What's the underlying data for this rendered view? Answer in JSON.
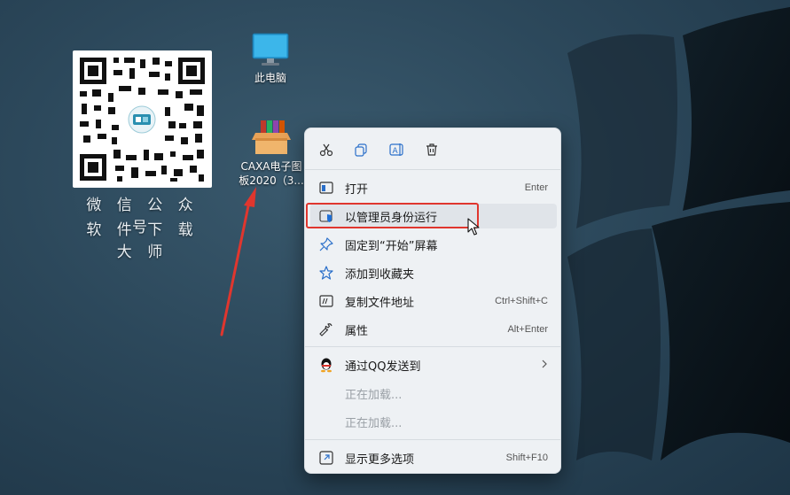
{
  "qr": {
    "caption_line1": "微 信 公 众 号",
    "caption_line2": "软 件 下 载 大 师"
  },
  "desktop_icons": [
    {
      "label": "此电脑",
      "icon": "monitor-icon"
    },
    {
      "label": "CAXA电子图板2020（3...",
      "icon": "package-box-icon"
    }
  ],
  "context_menu": {
    "toolbar": [
      {
        "name": "cut",
        "icon": "scissors-icon"
      },
      {
        "name": "copy",
        "icon": "copy-icon"
      },
      {
        "name": "rename",
        "icon": "rename-icon"
      },
      {
        "name": "delete",
        "icon": "trash-icon"
      }
    ],
    "items": [
      {
        "label": "打开",
        "shortcut": "Enter",
        "icon": "open-window-icon"
      },
      {
        "label": "以管理员身份运行",
        "shortcut": "",
        "icon": "shield-icon",
        "highlighted": true
      },
      {
        "label": "固定到“开始”屏幕",
        "shortcut": "",
        "icon": "pin-icon"
      },
      {
        "label": "添加到收藏夹",
        "shortcut": "",
        "icon": "star-icon"
      },
      {
        "label": "复制文件地址",
        "shortcut": "Ctrl+Shift+C",
        "icon": "path-icon"
      },
      {
        "label": "属性",
        "shortcut": "Alt+Enter",
        "icon": "wrench-icon"
      },
      {
        "label": "通过QQ发送到",
        "shortcut": "",
        "icon": "qq-penguin-icon",
        "submenu": true
      },
      {
        "label": "正在加载...",
        "shortcut": "",
        "disabled": true
      },
      {
        "label": "正在加载...",
        "shortcut": "",
        "disabled": true
      },
      {
        "label": "显示更多选项",
        "shortcut": "Shift+F10",
        "icon": "more-options-icon"
      }
    ]
  },
  "colors": {
    "highlight_border": "#e0362e",
    "annotation_arrow": "#e0362e",
    "admin_shield": "#1f6fd6"
  }
}
